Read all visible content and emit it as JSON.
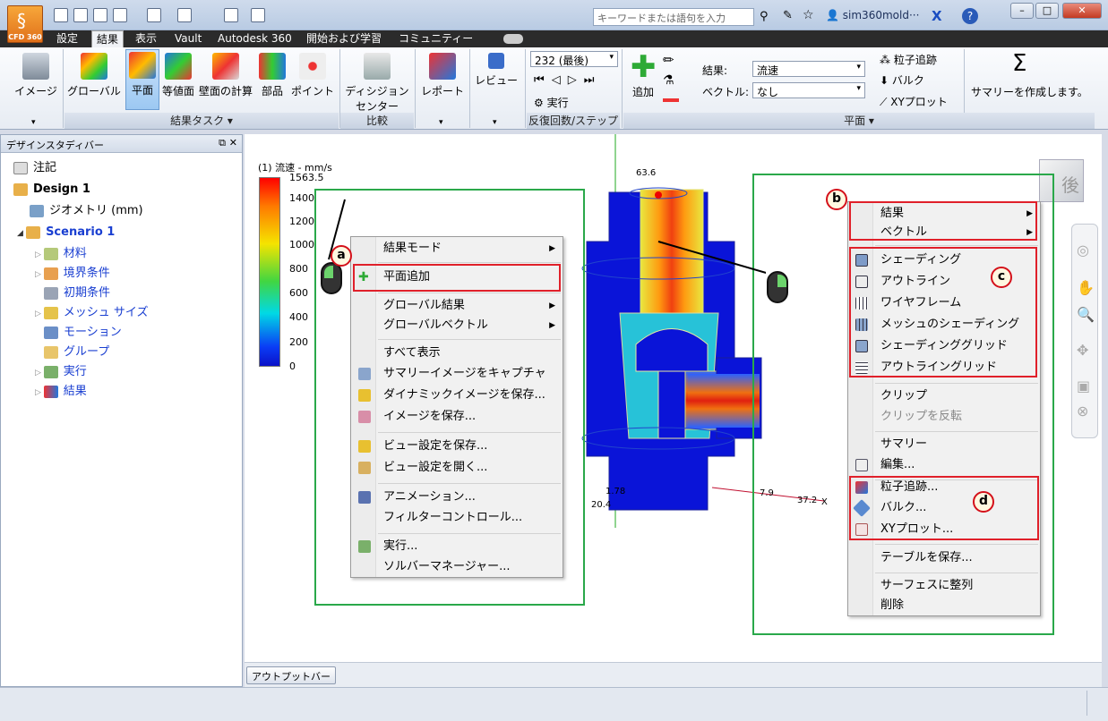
{
  "title_bar": {
    "logo_text": "CFD 360",
    "search_placeholder": "キーワードまたは語句を入力",
    "user": "sim360mold···"
  },
  "menubar": {
    "items": [
      "設定",
      "結果",
      "表示",
      "Vault",
      "Autodesk 360",
      "開始および学習",
      "コミュニティー"
    ],
    "active": "結果"
  },
  "ribbon": {
    "image_label": "イメージ",
    "global_label": "グローバル",
    "plane_label": "平面",
    "iso_label": "等値面",
    "wall_label": "壁面の計算",
    "part_label": "部品",
    "point_label": "ポイント",
    "decision_label": "ディシジョン",
    "decision_label2": "センター",
    "report_label": "レポート",
    "review_label": "レビュー",
    "group_result_tasks": "結果タスク ▾",
    "group_compare": "比較",
    "step_value": "232 (最後)",
    "run_label": "実行",
    "group_iter": "反復回数/ステップ",
    "add_label": "追加",
    "result_label": "結果:",
    "result_value": "流速",
    "vector_label": "ベクトル:",
    "vector_value": "なし",
    "particle_label": "粒子追跡",
    "bulk_label": "バルク",
    "xy_label": "XYプロット",
    "group_plane": "平面 ▾",
    "summary_label": "サマリーを作成します。"
  },
  "left_panel": {
    "header": "デザインスタディバー",
    "items": [
      "注記",
      "Design 1",
      "ジオメトリ (mm)",
      "Scenario 1",
      "材料",
      "境界条件",
      "初期条件",
      "メッシュ サイズ",
      "モーション",
      "グループ",
      "実行",
      "結果"
    ]
  },
  "legend": {
    "title": "(1) 流速 - mm/s",
    "ticks": [
      "1563.5",
      "1400",
      "1200",
      "1000",
      "800",
      "600",
      "400",
      "200",
      "0"
    ]
  },
  "viewport": {
    "dim_top": "63.6",
    "dim_a": "20.4",
    "dim_b": "7.9",
    "dim_c": "37.2",
    "dim_d": "1.78",
    "axis_x": "X",
    "cube_face": "後"
  },
  "ctx_left": {
    "items": [
      "結果モード",
      "平面追加",
      "グローバル結果",
      "グローバルベクトル",
      "すべて表示",
      "サマリーイメージをキャプチャ",
      "ダイナミックイメージを保存...",
      "イメージを保存...",
      "ビュー設定を保存...",
      "ビュー設定を開く...",
      "アニメーション...",
      "フィルターコントロール...",
      "実行...",
      "ソルバーマネージャー..."
    ]
  },
  "ctx_right": {
    "items": [
      "結果",
      "ベクトル",
      "シェーディング",
      "アウトライン",
      "ワイヤフレーム",
      "メッシュのシェーディング",
      "シェーディンググリッド",
      "アウトライングリッド",
      "クリップ",
      "クリップを反転",
      "サマリー",
      "編集...",
      "粒子追跡...",
      "バルク...",
      "XYプロット...",
      "テーブルを保存...",
      "サーフェスに整列",
      "削除"
    ]
  },
  "callouts": {
    "a": "a",
    "b": "b",
    "c": "c",
    "d": "d"
  },
  "output_bar": "アウトプットバー",
  "colors": {
    "accent_red": "#e0202a",
    "accent_green": "#2aa84a",
    "menubar": "#2b2b2b"
  }
}
